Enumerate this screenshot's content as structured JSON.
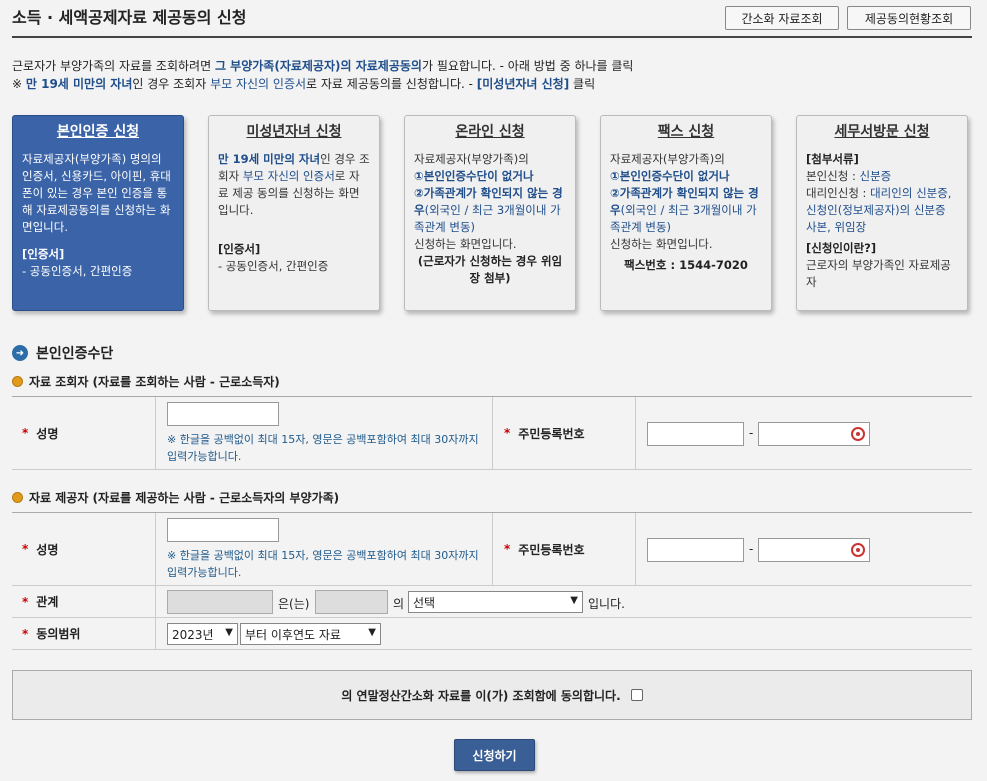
{
  "header": {
    "title": "소득 · 세액공제자료 제공동의 신청",
    "btn_simple": "간소화 자료조회",
    "btn_status": "제공동의현황조회"
  },
  "intro": {
    "line1_a": "근로자가 부양가족의 자료를 조회하려면 ",
    "line1_b": "그 부양가족(자료제공자)의 자료제공동의",
    "line1_c": "가 필요합니다. - 아래 방법 중 하나를 클릭",
    "line2_a": "※ ",
    "line2_b": "만 19세 미만의 자녀",
    "line2_c": "인 경우 조회자 ",
    "line2_d": "부모 자신의 인증서",
    "line2_e": "로 자료 제공동의를 신청합니다. - ",
    "line2_f": "[미성년자녀 신청]",
    "line2_g": " 클릭"
  },
  "cards": {
    "self": {
      "title": "본인인증 신청",
      "desc": "자료제공자(부양가족) 명의의 인증서, 신용카드, 아이핀, 휴대폰이 있는 경우 본인 인증을 통해 자료제공동의를 신청하는 화면입니다.",
      "cert_h": "[인증서]",
      "cert": "- 공동인증서, 간편인증"
    },
    "minor": {
      "title": "미성년자녀 신청",
      "desc_b": "만 19세 미만의 자녀",
      "desc_a": "인 경우 조회자 ",
      "desc_c": "부모 자신의 인증서",
      "desc_d": "로 자료 제공 동의를 신청하는 화면입니다.",
      "cert_h": "[인증서]",
      "cert": "- 공동인증서, 간편인증"
    },
    "online": {
      "title": "온라인 신청",
      "l1": "자료제공자(부양가족)의",
      "l2": "①본인인증수단이 없거나",
      "l3": "②가족관계가 확인되지 않는 경우",
      "l4": "(외국인 / 최근 3개월이내 가족관계 변동)",
      "l5": "신청하는 화면입니다.",
      "l6": "(근로자가 신청하는 경우 위임장 첨부)"
    },
    "fax": {
      "title": "팩스 신청",
      "l1": "자료제공자(부양가족)의",
      "l2": "①본인인증수단이 없거나",
      "l3": "②가족관계가 확인되지 않는 경우",
      "l4": "(외국인 / 최근 3개월이내 가족관계 변동)",
      "l5": "신청하는 화면입니다.",
      "l6": "팩스번호 : 1544-7020"
    },
    "visit": {
      "title": "세무서방문 신청",
      "h1": "[첨부서류]",
      "l1a": "본인신청 : ",
      "l1b": "신분증",
      "l2a": "대리인신청 : ",
      "l2b": "대리인의 신분증, 신청인(정보제공자)의 신분증 사본, 위임장",
      "h2": "[신청인이란?]",
      "l3": "근로자의 부양가족인 자료제공자"
    }
  },
  "section": {
    "title": "본인인증수단",
    "viewer_h": "자료 조회자 (자료를 조회하는 사람 - 근로소득자)",
    "provider_h": "자료 제공자 (자료를 제공하는 사람 - 근로소득자의 부양가족)"
  },
  "form": {
    "req": "*",
    "name_label": "성명",
    "rrn_label": "주민등록번호",
    "name_note": "※ 한글을 공백없이 최대 15자, 영문은 공백포함하여 최대 30자까지 입력가능합니다.",
    "dash": "-",
    "relation_label": "관계",
    "relation_eun": "은(는)",
    "relation_ui": "의",
    "relation_select": "선택",
    "relation_end": "입니다.",
    "scope_label": "동의범위",
    "scope_year": "2023년",
    "scope_range": "부터 이후연도 자료"
  },
  "agree": {
    "text": "의 연말정산간소화 자료를 이(가) 조회함에 동의합니다."
  },
  "submit": "신청하기"
}
